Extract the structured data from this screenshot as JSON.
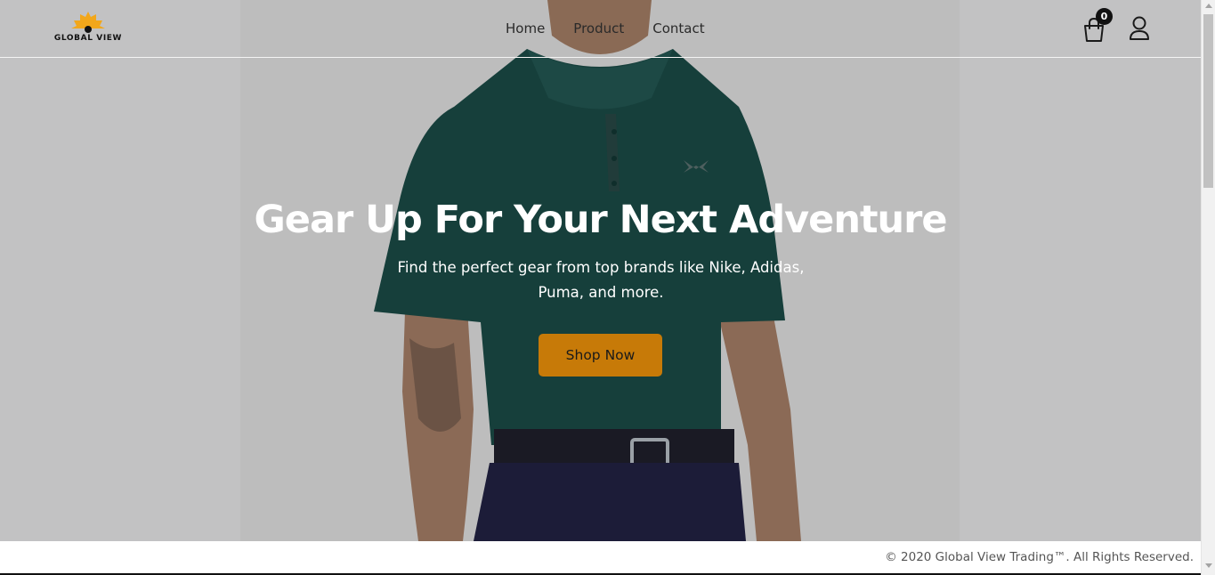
{
  "brand": {
    "name": "GLOBAL VIEW"
  },
  "nav": {
    "items": [
      {
        "label": "Home"
      },
      {
        "label": "Product"
      },
      {
        "label": "Contact"
      }
    ]
  },
  "cart": {
    "icon": "shopping-bag-icon",
    "count": "0"
  },
  "user": {
    "icon": "user-icon"
  },
  "hero": {
    "title": "Gear Up For Your Next Adventure",
    "subtitle": "Find the perfect gear from top brands like Nike, Adidas, Puma, and more.",
    "cta_label": "Shop Now",
    "image_alt": "Model wearing a dark green polo shirt and navy pants"
  },
  "footer": {
    "copyright": "© 2020 Global View Trading™. All Rights Reserved."
  },
  "colors": {
    "accent": "#c77a08",
    "hero_overlay": "#c2c2c3",
    "text_on_hero": "#ffffff",
    "logo_sun": "#f2a71b"
  }
}
